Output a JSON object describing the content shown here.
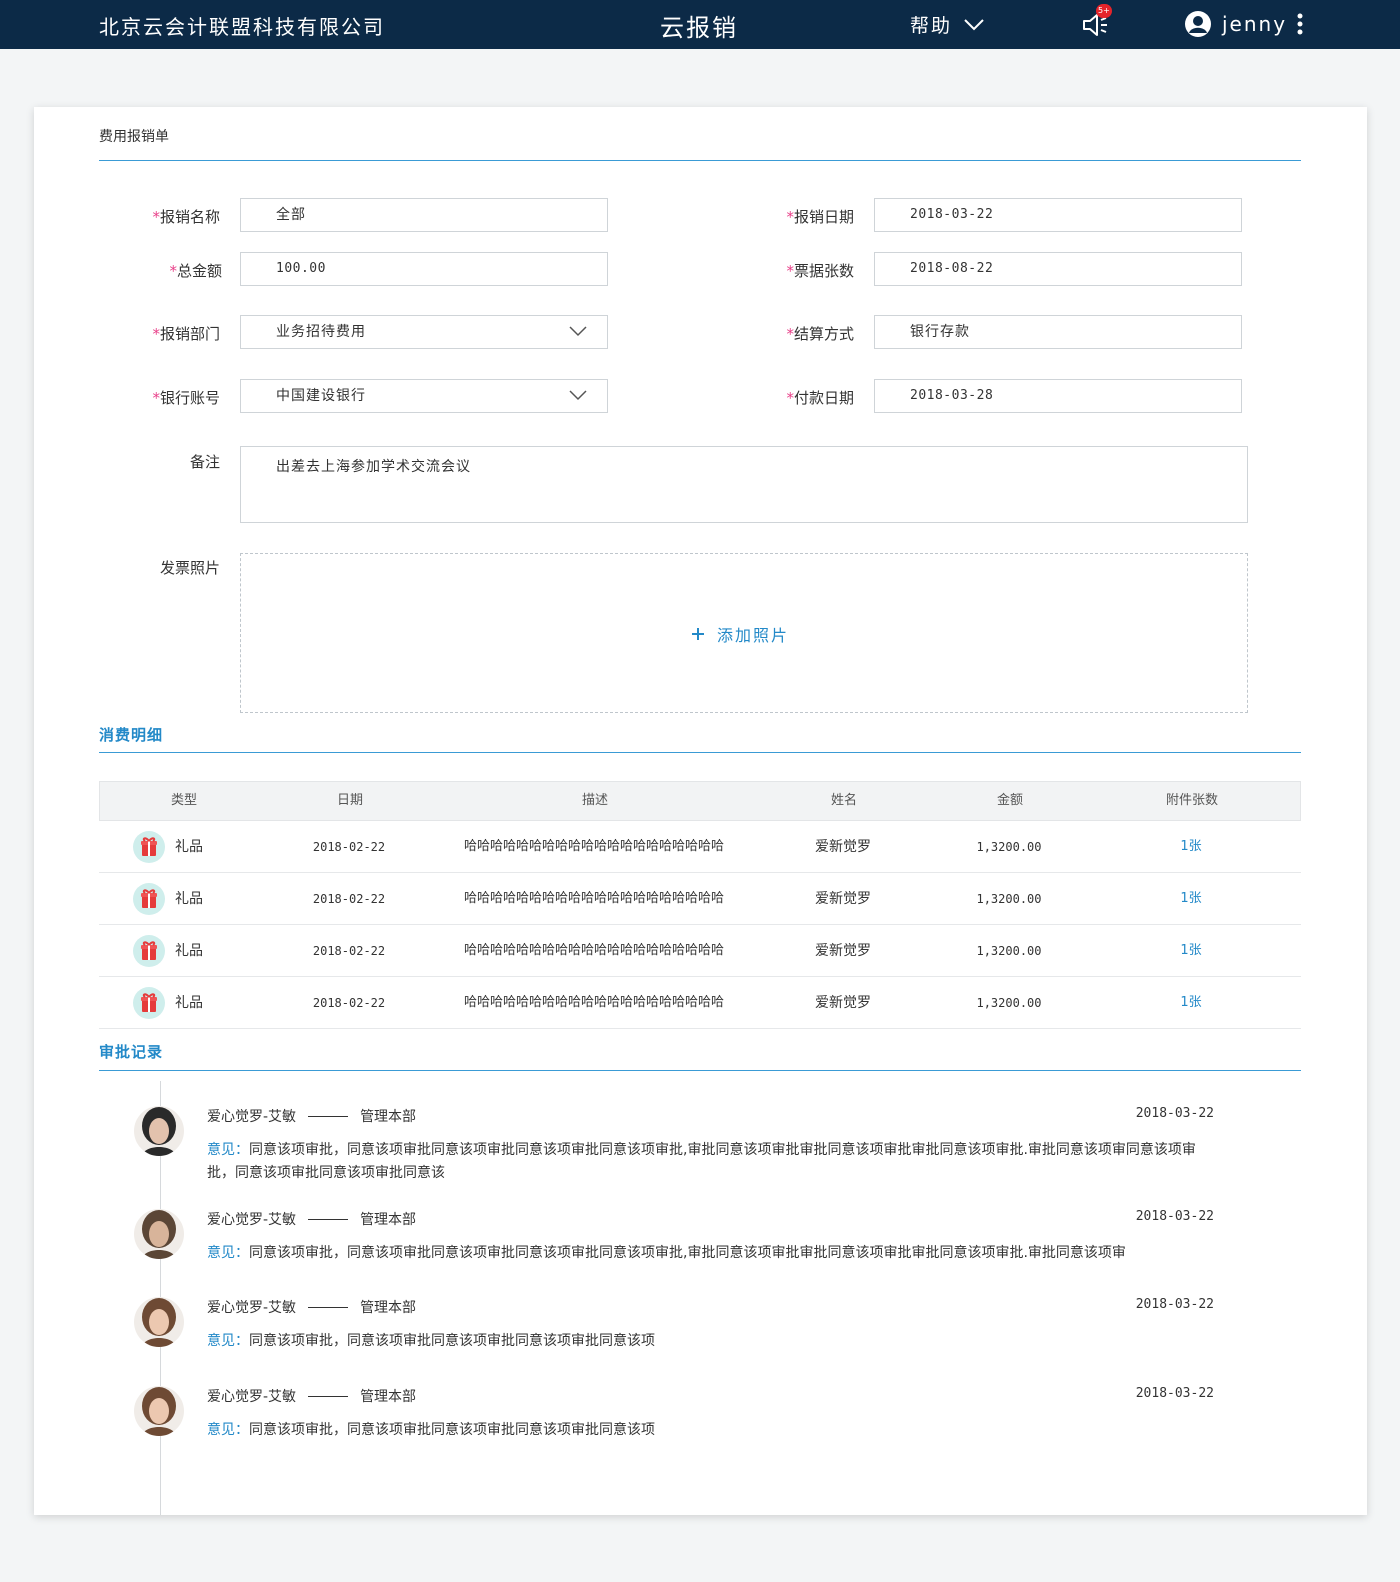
{
  "header": {
    "company": "北京云会计联盟科技有限公司",
    "app_title": "云报销",
    "help_label": "帮助",
    "notification_count": "5+",
    "username": "jenny"
  },
  "form": {
    "title": "费用报销单",
    "fields": {
      "name": {
        "label": "报销名称",
        "value": "全部"
      },
      "date": {
        "label": "报销日期",
        "value": "2018-03-22"
      },
      "amount": {
        "label": "总金额",
        "value": "100.00"
      },
      "invoice_count": {
        "label": "票据张数",
        "value": "2018-08-22"
      },
      "department": {
        "label": "报销部门",
        "value": "业务招待费用"
      },
      "settlement": {
        "label": "结算方式",
        "value": "银行存款"
      },
      "bank": {
        "label": "银行账号",
        "value": "中国建设银行"
      },
      "pay_date": {
        "label": "付款日期",
        "value": "2018-03-28"
      },
      "remark": {
        "label": "备注",
        "value": "出差去上海参加学术交流会议"
      },
      "photos": {
        "label": "发票照片",
        "add_label": "添加照片"
      }
    },
    "required_mark": "*"
  },
  "details": {
    "title": "消费明细",
    "columns": [
      "类型",
      "日期",
      "描述",
      "姓名",
      "金额",
      "附件张数"
    ],
    "rows": [
      {
        "type": "礼品",
        "date": "2018-02-22",
        "desc": "哈哈哈哈哈哈哈哈哈哈哈哈哈哈哈哈哈哈哈哈",
        "name": "爱新觉罗",
        "amount": "1,3200.00",
        "attachments": "1张"
      },
      {
        "type": "礼品",
        "date": "2018-02-22",
        "desc": "哈哈哈哈哈哈哈哈哈哈哈哈哈哈哈哈哈哈哈哈",
        "name": "爱新觉罗",
        "amount": "1,3200.00",
        "attachments": "1张"
      },
      {
        "type": "礼品",
        "date": "2018-02-22",
        "desc": "哈哈哈哈哈哈哈哈哈哈哈哈哈哈哈哈哈哈哈哈",
        "name": "爱新觉罗",
        "amount": "1,3200.00",
        "attachments": "1张"
      },
      {
        "type": "礼品",
        "date": "2018-02-22",
        "desc": "哈哈哈哈哈哈哈哈哈哈哈哈哈哈哈哈哈哈哈哈",
        "name": "爱新觉罗",
        "amount": "1,3200.00",
        "attachments": "1张"
      }
    ]
  },
  "approvals": {
    "title": "审批记录",
    "opinion_label": "意见：",
    "records": [
      {
        "name": "爱心觉罗-艾敏",
        "dept": "管理本部",
        "date": "2018-03-22",
        "text": "同意该项审批，同意该项审批同意该项审批同意该项审批同意该项审批,审批同意该项审批审批同意该项审批审批同意该项审批.审批同意该项审同意该项审批，同意该项审批同意该项审批同意该"
      },
      {
        "name": "爱心觉罗-艾敏",
        "dept": "管理本部",
        "date": "2018-03-22",
        "text": "同意该项审批，同意该项审批同意该项审批同意该项审批同意该项审批,审批同意该项审批审批同意该项审批审批同意该项审批.审批同意该项审"
      },
      {
        "name": "爱心觉罗-艾敏",
        "dept": "管理本部",
        "date": "2018-03-22",
        "text": "同意该项审批，同意该项审批同意该项审批同意该项审批同意该项"
      },
      {
        "name": "爱心觉罗-艾敏",
        "dept": "管理本部",
        "date": "2018-03-22",
        "text": "同意该项审批，同意该项审批同意该项审批同意该项审批同意该项"
      }
    ]
  },
  "colors": {
    "topbar": "#0c2a47",
    "accent": "#2389c8",
    "required": "#e8418a",
    "badge": "#e5242b"
  }
}
